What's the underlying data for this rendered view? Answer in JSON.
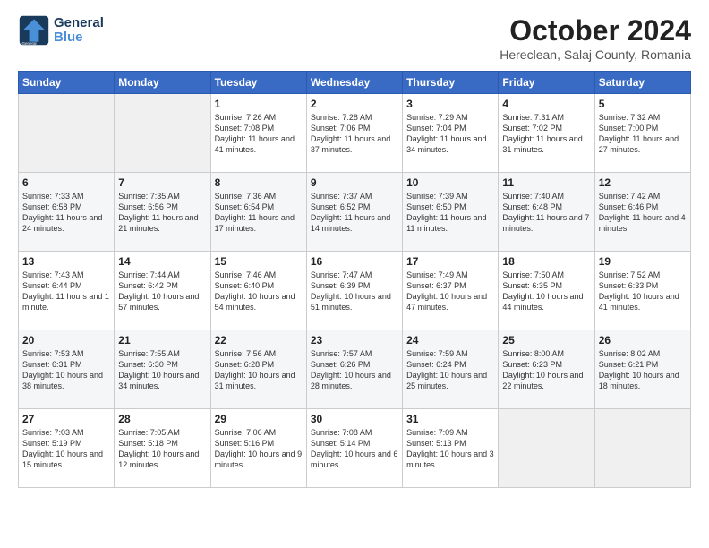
{
  "logo": {
    "line1": "General",
    "line2": "Blue"
  },
  "title": "October 2024",
  "subtitle": "Hereclean, Salaj County, Romania",
  "weekdays": [
    "Sunday",
    "Monday",
    "Tuesday",
    "Wednesday",
    "Thursday",
    "Friday",
    "Saturday"
  ],
  "weeks": [
    [
      {
        "day": "",
        "info": ""
      },
      {
        "day": "",
        "info": ""
      },
      {
        "day": "1",
        "info": "Sunrise: 7:26 AM\nSunset: 7:08 PM\nDaylight: 11 hours and 41 minutes."
      },
      {
        "day": "2",
        "info": "Sunrise: 7:28 AM\nSunset: 7:06 PM\nDaylight: 11 hours and 37 minutes."
      },
      {
        "day": "3",
        "info": "Sunrise: 7:29 AM\nSunset: 7:04 PM\nDaylight: 11 hours and 34 minutes."
      },
      {
        "day": "4",
        "info": "Sunrise: 7:31 AM\nSunset: 7:02 PM\nDaylight: 11 hours and 31 minutes."
      },
      {
        "day": "5",
        "info": "Sunrise: 7:32 AM\nSunset: 7:00 PM\nDaylight: 11 hours and 27 minutes."
      }
    ],
    [
      {
        "day": "6",
        "info": "Sunrise: 7:33 AM\nSunset: 6:58 PM\nDaylight: 11 hours and 24 minutes."
      },
      {
        "day": "7",
        "info": "Sunrise: 7:35 AM\nSunset: 6:56 PM\nDaylight: 11 hours and 21 minutes."
      },
      {
        "day": "8",
        "info": "Sunrise: 7:36 AM\nSunset: 6:54 PM\nDaylight: 11 hours and 17 minutes."
      },
      {
        "day": "9",
        "info": "Sunrise: 7:37 AM\nSunset: 6:52 PM\nDaylight: 11 hours and 14 minutes."
      },
      {
        "day": "10",
        "info": "Sunrise: 7:39 AM\nSunset: 6:50 PM\nDaylight: 11 hours and 11 minutes."
      },
      {
        "day": "11",
        "info": "Sunrise: 7:40 AM\nSunset: 6:48 PM\nDaylight: 11 hours and 7 minutes."
      },
      {
        "day": "12",
        "info": "Sunrise: 7:42 AM\nSunset: 6:46 PM\nDaylight: 11 hours and 4 minutes."
      }
    ],
    [
      {
        "day": "13",
        "info": "Sunrise: 7:43 AM\nSunset: 6:44 PM\nDaylight: 11 hours and 1 minute."
      },
      {
        "day": "14",
        "info": "Sunrise: 7:44 AM\nSunset: 6:42 PM\nDaylight: 10 hours and 57 minutes."
      },
      {
        "day": "15",
        "info": "Sunrise: 7:46 AM\nSunset: 6:40 PM\nDaylight: 10 hours and 54 minutes."
      },
      {
        "day": "16",
        "info": "Sunrise: 7:47 AM\nSunset: 6:39 PM\nDaylight: 10 hours and 51 minutes."
      },
      {
        "day": "17",
        "info": "Sunrise: 7:49 AM\nSunset: 6:37 PM\nDaylight: 10 hours and 47 minutes."
      },
      {
        "day": "18",
        "info": "Sunrise: 7:50 AM\nSunset: 6:35 PM\nDaylight: 10 hours and 44 minutes."
      },
      {
        "day": "19",
        "info": "Sunrise: 7:52 AM\nSunset: 6:33 PM\nDaylight: 10 hours and 41 minutes."
      }
    ],
    [
      {
        "day": "20",
        "info": "Sunrise: 7:53 AM\nSunset: 6:31 PM\nDaylight: 10 hours and 38 minutes."
      },
      {
        "day": "21",
        "info": "Sunrise: 7:55 AM\nSunset: 6:30 PM\nDaylight: 10 hours and 34 minutes."
      },
      {
        "day": "22",
        "info": "Sunrise: 7:56 AM\nSunset: 6:28 PM\nDaylight: 10 hours and 31 minutes."
      },
      {
        "day": "23",
        "info": "Sunrise: 7:57 AM\nSunset: 6:26 PM\nDaylight: 10 hours and 28 minutes."
      },
      {
        "day": "24",
        "info": "Sunrise: 7:59 AM\nSunset: 6:24 PM\nDaylight: 10 hours and 25 minutes."
      },
      {
        "day": "25",
        "info": "Sunrise: 8:00 AM\nSunset: 6:23 PM\nDaylight: 10 hours and 22 minutes."
      },
      {
        "day": "26",
        "info": "Sunrise: 8:02 AM\nSunset: 6:21 PM\nDaylight: 10 hours and 18 minutes."
      }
    ],
    [
      {
        "day": "27",
        "info": "Sunrise: 7:03 AM\nSunset: 5:19 PM\nDaylight: 10 hours and 15 minutes."
      },
      {
        "day": "28",
        "info": "Sunrise: 7:05 AM\nSunset: 5:18 PM\nDaylight: 10 hours and 12 minutes."
      },
      {
        "day": "29",
        "info": "Sunrise: 7:06 AM\nSunset: 5:16 PM\nDaylight: 10 hours and 9 minutes."
      },
      {
        "day": "30",
        "info": "Sunrise: 7:08 AM\nSunset: 5:14 PM\nDaylight: 10 hours and 6 minutes."
      },
      {
        "day": "31",
        "info": "Sunrise: 7:09 AM\nSunset: 5:13 PM\nDaylight: 10 hours and 3 minutes."
      },
      {
        "day": "",
        "info": ""
      },
      {
        "day": "",
        "info": ""
      }
    ]
  ]
}
